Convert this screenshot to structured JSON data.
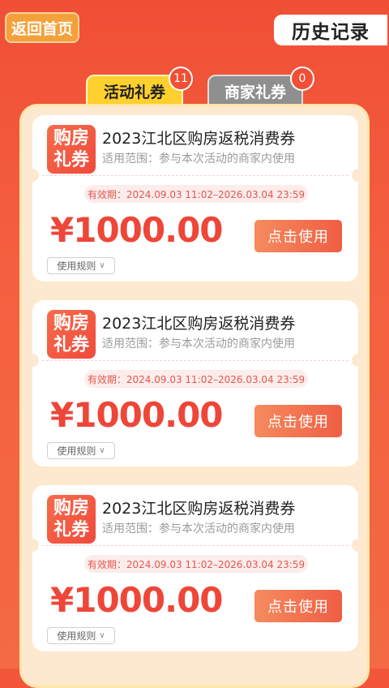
{
  "header": {
    "back_label": "返回首页",
    "history_label": "历史记录"
  },
  "tabs": [
    {
      "label": "活动礼券",
      "count": "11",
      "active": true
    },
    {
      "label": "商家礼券",
      "count": "0",
      "active": false
    }
  ],
  "coupons": [
    {
      "icon_line1": "购房",
      "icon_line2": "礼券",
      "title": "2023江北区购房返税消费券",
      "scope": "适用范围：参与本次活动的商家内使用",
      "validity": "有效期：2024.09.03 11:02–2026.03.04 23:59",
      "amount": "¥1000.00",
      "use_label": "点击使用",
      "rules_label": "使用规则"
    },
    {
      "icon_line1": "购房",
      "icon_line2": "礼券",
      "title": "2023江北区购房返税消费券",
      "scope": "适用范围：参与本次活动的商家内使用",
      "validity": "有效期：2024.09.03 11:02–2026.03.04 23:59",
      "amount": "¥1000.00",
      "use_label": "点击使用",
      "rules_label": "使用规则"
    },
    {
      "icon_line1": "购房",
      "icon_line2": "礼券",
      "title": "2023江北区购房返税消费券",
      "scope": "适用范围：参与本次活动的商家内使用",
      "validity": "有效期：2024.09.03 11:02–2026.03.04 23:59",
      "amount": "¥1000.00",
      "use_label": "点击使用",
      "rules_label": "使用规则"
    }
  ],
  "colors": {
    "background": "#f3563a",
    "accent": "#ee4638",
    "active_tab": "#ffd02e",
    "inactive_tab": "#8f8f8f"
  }
}
